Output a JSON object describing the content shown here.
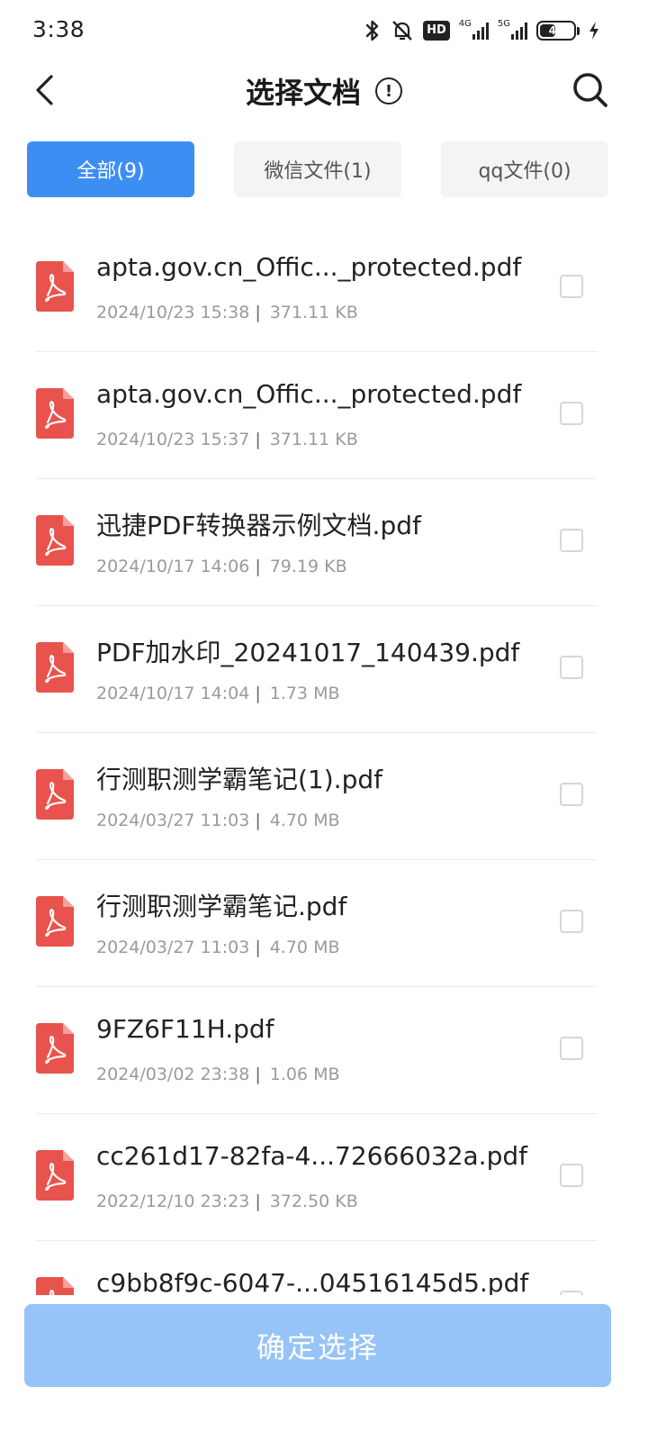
{
  "status_bar": {
    "time": "3:38",
    "hd_label": "HD",
    "net1": "4G",
    "net2": "5G",
    "battery": "48",
    "battery_level_percent": 48
  },
  "header": {
    "title": "选择文档",
    "info_glyph": "!"
  },
  "tabs": [
    {
      "label": "全部(9)",
      "active": true
    },
    {
      "label": "微信文件(1)",
      "active": false
    },
    {
      "label": "qq文件(0)",
      "active": false
    }
  ],
  "files": [
    {
      "name": "apta.gov.cn_Offic..._protected.pdf",
      "date": "2024/10/23 15:38",
      "size": "371.11 KB"
    },
    {
      "name": "apta.gov.cn_Offic..._protected.pdf",
      "date": "2024/10/23 15:37",
      "size": "371.11 KB"
    },
    {
      "name": "迅捷PDF转换器示例文档.pdf",
      "date": "2024/10/17 14:06",
      "size": "79.19 KB"
    },
    {
      "name": "PDF加水印_20241017_140439.pdf",
      "date": "2024/10/17 14:04",
      "size": "1.73 MB"
    },
    {
      "name": " 行测职测学霸笔记(1).pdf",
      "date": "2024/03/27 11:03",
      "size": "4.70 MB"
    },
    {
      "name": " 行测职测学霸笔记.pdf",
      "date": "2024/03/27 11:03",
      "size": "4.70 MB"
    },
    {
      "name": "9FZ6F11H.pdf",
      "date": "2024/03/02 23:38",
      "size": "1.06 MB"
    },
    {
      "name": "cc261d17-82fa-4...72666032a.pdf",
      "date": "2022/12/10 23:23",
      "size": "372.50 KB"
    },
    {
      "name": "c9bb8f9c-6047-...04516145d5.pdf",
      "date": "",
      "size": ""
    }
  ],
  "meta_separator": "|",
  "confirm_label": "确定选择",
  "colors": {
    "accent": "#3d8ef3",
    "confirm_disabled": "#96c3f8",
    "pdf_icon": "#e8534d"
  },
  "icons": {
    "back": "chevron-left-icon",
    "info": "info-circle-icon",
    "search": "search-icon",
    "file": "pdf-file-icon",
    "bluetooth": "bluetooth-icon",
    "mute": "bell-off-icon",
    "charging": "lightning-icon"
  }
}
